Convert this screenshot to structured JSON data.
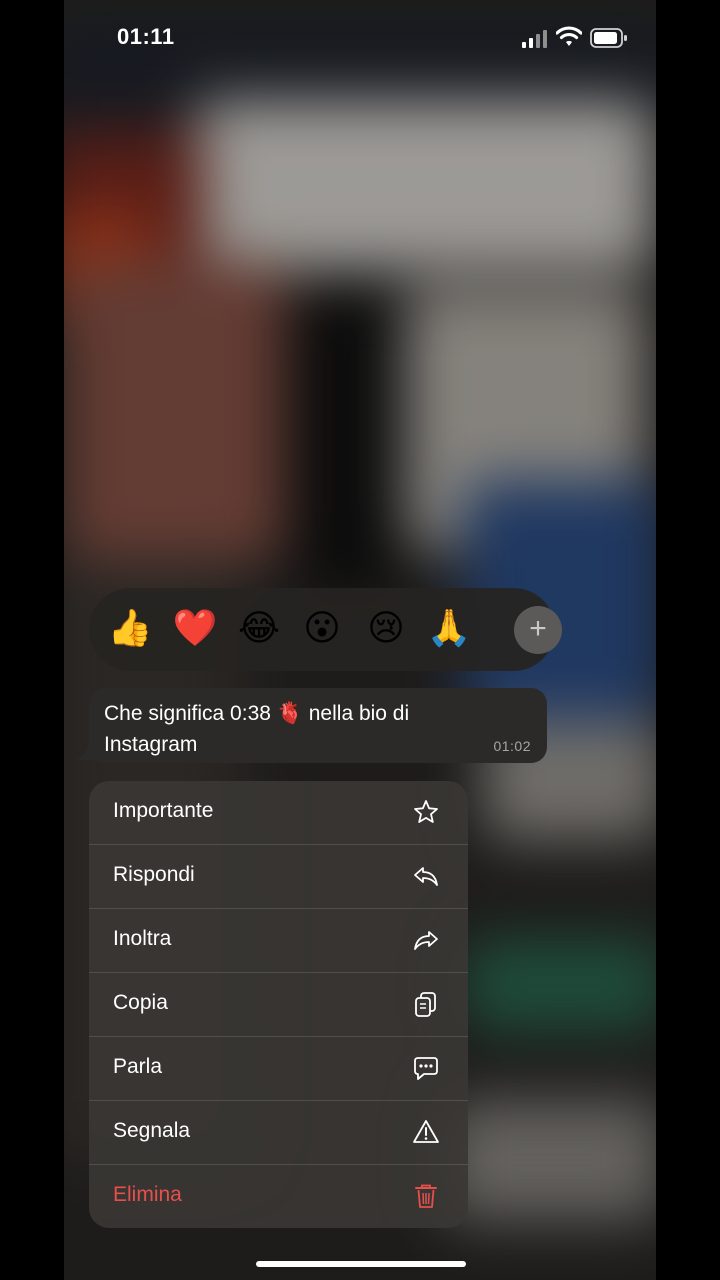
{
  "status_bar": {
    "time": "01:11"
  },
  "reactions": {
    "emojis": [
      {
        "name": "thumbs-up",
        "char": "👍"
      },
      {
        "name": "heart",
        "char": "❤️"
      },
      {
        "name": "tears-of-joy",
        "char": "😂"
      },
      {
        "name": "surprised",
        "char": "😮"
      },
      {
        "name": "crying",
        "char": "😢"
      },
      {
        "name": "pray",
        "char": "🙏"
      }
    ],
    "more_label": "+"
  },
  "message": {
    "text": "Che significa  0:38 🫀 nella bio di Instagram",
    "time": "01:02"
  },
  "menu": {
    "items": [
      {
        "label": "Importante",
        "icon": "star-icon"
      },
      {
        "label": "Rispondi",
        "icon": "reply-icon"
      },
      {
        "label": "Inoltra",
        "icon": "forward-icon"
      },
      {
        "label": "Copia",
        "icon": "copy-icon"
      },
      {
        "label": "Parla",
        "icon": "speech-bubble-icon"
      },
      {
        "label": "Segnala",
        "icon": "warning-icon"
      },
      {
        "label": "Elimina",
        "icon": "trash-icon"
      }
    ]
  },
  "colors": {
    "danger": "#e5504d",
    "bubble": "#2b2a29",
    "menu": "#3a3734"
  }
}
